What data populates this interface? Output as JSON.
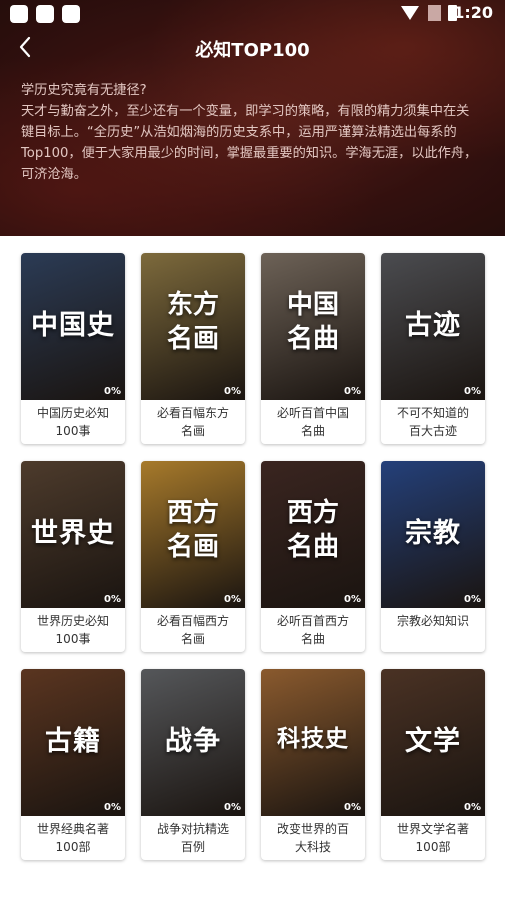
{
  "status": {
    "time": "1:20"
  },
  "nav": {
    "title": "必知TOP100"
  },
  "intro": {
    "line1": "学历史究竟有无捷径?",
    "line2": "天才与勤奋之外，至少还有一个变量，即学习的策略，有限的精力须集中在关键目标上。“全历史”从浩如烟海的历史支系中，运用严谨算法精选出每系的Top100，便于大家用最少的时间，掌握最重要的知识。学海无涯，以此作舟，可济沧海。"
  },
  "cards": [
    {
      "cover": "中国史",
      "progress": "0%",
      "label": "中国历史必知100事",
      "bg": "#2b3b55"
    },
    {
      "cover": "东方名画",
      "progress": "0%",
      "label": "必看百幅东方名画",
      "bg": "#7d6a3c"
    },
    {
      "cover": "中国名曲",
      "progress": "0%",
      "label": "必听百首中国名曲",
      "bg": "#6d6257"
    },
    {
      "cover": "古迹",
      "progress": "0%",
      "label": "不可不知道的百大古迹",
      "bg": "#4b4c50"
    },
    {
      "cover": "世界史",
      "progress": "0%",
      "label": "世界历史必知100事",
      "bg": "#4d3b2c"
    },
    {
      "cover": "西方名画",
      "progress": "0%",
      "label": "必看百幅西方名画",
      "bg": "#a77a2b"
    },
    {
      "cover": "西方名曲",
      "progress": "0%",
      "label": "必听百首西方名曲",
      "bg": "#3a2520"
    },
    {
      "cover": "宗教",
      "progress": "0%",
      "label": "宗教必知知识",
      "bg": "#24407a"
    },
    {
      "cover": "古籍",
      "progress": "0%",
      "label": "世界经典名著100部",
      "bg": "#5a3520"
    },
    {
      "cover": "战争",
      "progress": "0%",
      "label": "战争对抗精选百例",
      "bg": "#55575a"
    },
    {
      "cover": "科技史",
      "progress": "0%",
      "label": "改变世界的百大科技",
      "bg": "#8a5a2e"
    },
    {
      "cover": "文学",
      "progress": "0%",
      "label": "世界文学名著100部",
      "bg": "#4a3224"
    }
  ]
}
